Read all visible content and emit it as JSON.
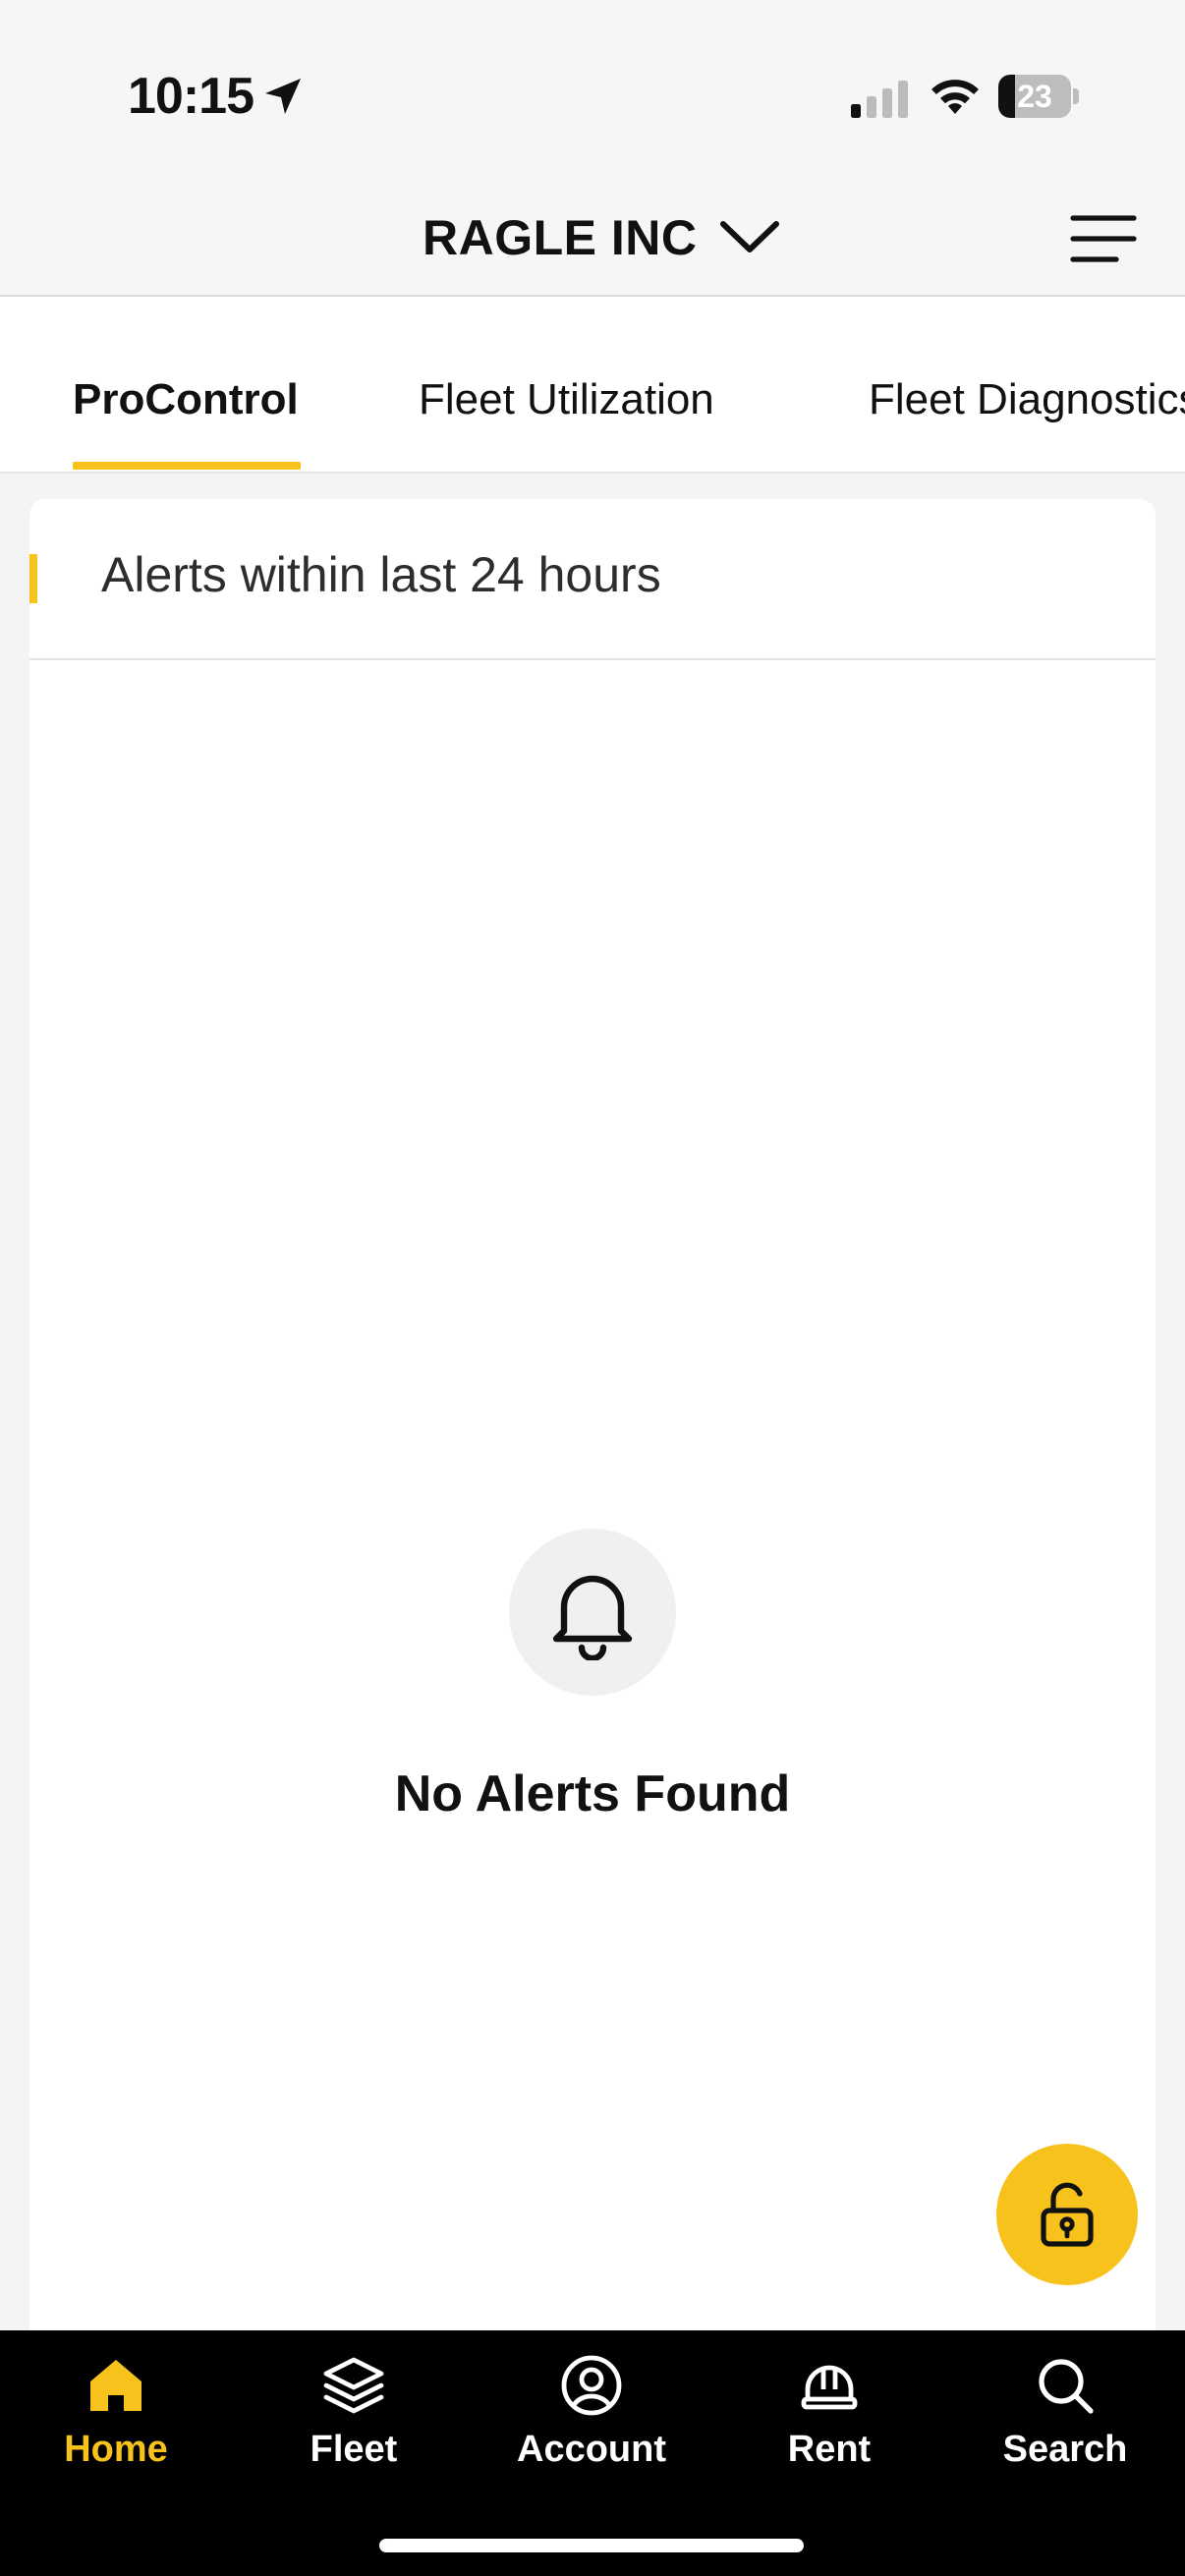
{
  "status_bar": {
    "time": "10:15",
    "battery_level": "23",
    "icons": [
      "location-arrow-icon",
      "cellular-signal-icon",
      "wifi-icon",
      "battery-icon"
    ]
  },
  "header": {
    "company_name": "RAGLE INC",
    "icons": [
      "chevron-down-icon",
      "hamburger-menu-icon"
    ]
  },
  "tabs": [
    {
      "label": "ProControl",
      "active": true
    },
    {
      "label": "Fleet Utilization",
      "active": false
    },
    {
      "label": "Fleet Diagnostics",
      "active": false
    }
  ],
  "alerts_card": {
    "title": "Alerts within last 24 hours",
    "empty_message": "No Alerts Found",
    "empty_icon": "bell-icon"
  },
  "fab": {
    "icon": "unlock-icon"
  },
  "bottom_nav": [
    {
      "label": "Home",
      "icon": "home-icon",
      "active": true
    },
    {
      "label": "Fleet",
      "icon": "layers-icon",
      "active": false
    },
    {
      "label": "Account",
      "icon": "account-circle-icon",
      "active": false
    },
    {
      "label": "Rent",
      "icon": "hard-hat-icon",
      "active": false
    },
    {
      "label": "Search",
      "icon": "search-icon",
      "active": false
    }
  ],
  "colors": {
    "accent": "#f7c21c",
    "nav_background": "#000000",
    "header_background": "#f6f6f6"
  }
}
